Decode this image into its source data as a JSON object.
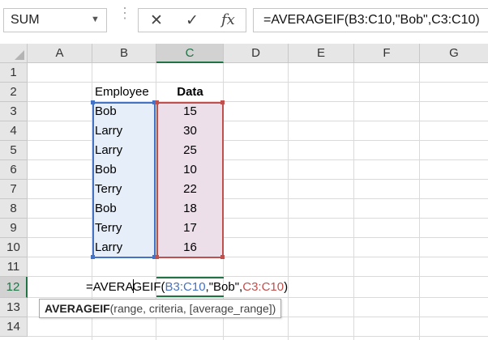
{
  "formula_bar": {
    "name_box": "SUM",
    "cancel_icon": "cancel-icon",
    "enter_icon": "checkmark-icon",
    "function_icon": "fx-icon",
    "function_label": "fx",
    "formula": "=AVERAGEIF(B3:C10,\"Bob\",C3:C10)"
  },
  "columns": [
    "A",
    "B",
    "C",
    "D",
    "E",
    "F",
    "G"
  ],
  "rows": [
    "1",
    "2",
    "3",
    "4",
    "5",
    "6",
    "7",
    "8",
    "9",
    "10",
    "11",
    "12",
    "13",
    "14"
  ],
  "table": {
    "header_employee": "Employee",
    "header_data": "Data",
    "employees": [
      "Bob",
      "Larry",
      "Larry",
      "Bob",
      "Terry",
      "Bob",
      "Terry",
      "Larry"
    ],
    "data": [
      "15",
      "30",
      "25",
      "10",
      "22",
      "18",
      "17",
      "16"
    ]
  },
  "cell_formula": {
    "prefix": "=AVERA",
    "prefix2": "GEIF(",
    "range1": "B3:C10",
    "mid": ",\"Bob\",",
    "range2": "C3:C10",
    "suffix": ")"
  },
  "tooltip": {
    "function_name": "AVERAGEIF",
    "args": "(range, criteria, [average_range])"
  },
  "colors": {
    "accent_green": "#217346",
    "range_blue": "#4472c4",
    "range_red": "#c0504d"
  }
}
